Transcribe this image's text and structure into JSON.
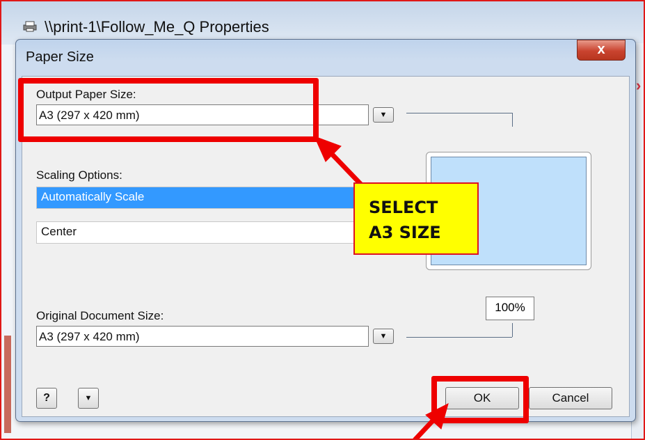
{
  "parent_window": {
    "title": "\\\\print-1\\Follow_Me_Q Properties"
  },
  "dialog": {
    "title": "Paper Size",
    "close_label": "x",
    "output_paper_size": {
      "label": "Output Paper Size:",
      "value": "A3 (297 x 420 mm)"
    },
    "scaling_options": {
      "label": "Scaling Options:",
      "items": [
        "Automatically Scale"
      ],
      "selected": "Automatically Scale"
    },
    "position": {
      "value": "Center"
    },
    "original_document_size": {
      "label": "Original Document Size:",
      "value": "A3 (297 x 420 mm)"
    },
    "zoom_percent": "100%",
    "buttons": {
      "help": "?",
      "menu": "▼",
      "ok": "OK",
      "cancel": "Cancel"
    }
  },
  "annotation": {
    "callout_line1": "SELECT",
    "callout_line2": "A3 SIZE"
  },
  "colors": {
    "highlight": "#ee0000",
    "callout_fill": "#ffff00",
    "selection": "#3399ff",
    "preview_fill": "#bfe0fb"
  }
}
